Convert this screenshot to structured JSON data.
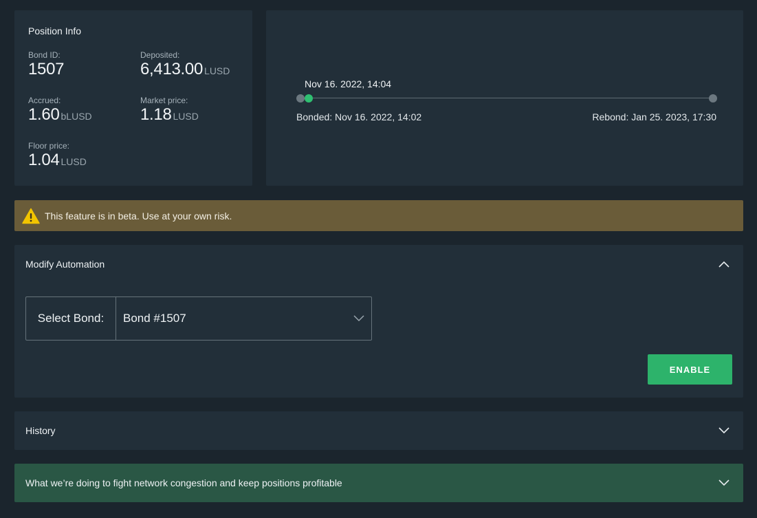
{
  "position_info": {
    "title": "Position Info",
    "bond_id_label": "Bond ID:",
    "bond_id": "1507",
    "deposited_label": "Deposited:",
    "deposited_value": "6,413.00",
    "deposited_unit": "LUSD",
    "accrued_label": "Accrued:",
    "accrued_value": "1.60",
    "accrued_unit": "bLUSD",
    "market_price_label": "Market price:",
    "market_price_value": "1.18",
    "market_price_unit": "LUSD",
    "floor_price_label": "Floor price:",
    "floor_price_value": "1.04",
    "floor_price_unit": "LUSD"
  },
  "timeline": {
    "current": "Nov 16. 2022, 14:04",
    "bonded": "Bonded: Nov 16. 2022, 14:02",
    "rebond": "Rebond: Jan 25. 2023, 17:30"
  },
  "beta_banner": {
    "text": "This feature is in beta. Use at your own risk.",
    "icon": "warning-icon"
  },
  "automation": {
    "title": "Modify Automation",
    "select_label": "Select Bond:",
    "selected_bond": "Bond #1507",
    "enable_label": "ENABLE"
  },
  "history": {
    "title": "History"
  },
  "congestion": {
    "title": "What we’re doing to fight network congestion and keep positions profitable"
  },
  "colors": {
    "background": "#1b252d",
    "panel": "#222f39",
    "accent_green": "#2db36b",
    "warning_bg": "#6a5c39",
    "info_green_bg": "#2a5745",
    "warning_yellow": "#f2c400"
  }
}
